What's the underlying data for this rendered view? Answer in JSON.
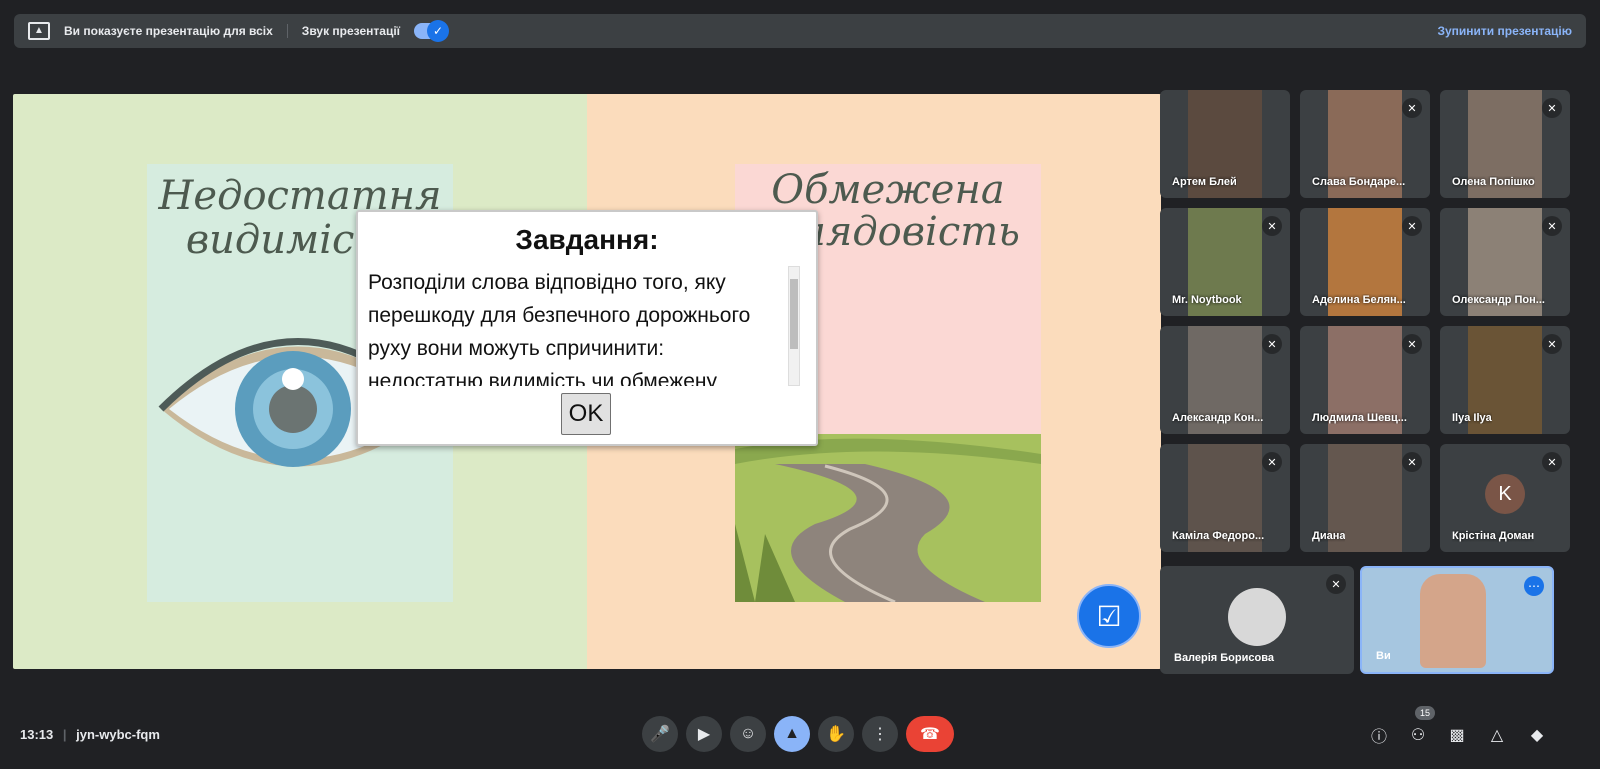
{
  "banner": {
    "presenting_text": "Ви показуєте презентацію для всіх",
    "sound_label": "Звук презентації",
    "stop_label": "Зупинити презентацію",
    "toggle_on": true
  },
  "slide": {
    "left_title_line1": "Недостатня",
    "left_title_line2": "видимість",
    "right_title_line1": "Обмежена",
    "right_title_line2": "оглядовість"
  },
  "dialog": {
    "heading": "Завдання:",
    "body": "Розподіли слова відповідно того, яку перешкоду для безпечного дорожнього руху вони можуть спричинити: недостатню видимість чи обмежену оглядовість.",
    "ok_label": "OK"
  },
  "participants": [
    {
      "name": "Артем Блей",
      "muted": false,
      "color": "#5b4a3f"
    },
    {
      "name": "Слава Бондаре...",
      "muted": true,
      "color": "#8a6a58"
    },
    {
      "name": "Олена Попішко",
      "muted": true,
      "color": "#7d6e63"
    },
    {
      "name": "Mr. Noytbook",
      "muted": true,
      "color": "#6e7a4e"
    },
    {
      "name": "Аделина Белян...",
      "muted": true,
      "color": "#b3763e"
    },
    {
      "name": "Олександр Пон...",
      "muted": true,
      "color": "#8c8176"
    },
    {
      "name": "Александр Кон...",
      "muted": true,
      "color": "#6f6964"
    },
    {
      "name": "Людмила Шевц...",
      "muted": true,
      "color": "#8c6f66"
    },
    {
      "name": "Ilya Ilya",
      "muted": true,
      "color": "#6a5436"
    },
    {
      "name": "Каміла Федоро...",
      "muted": true,
      "color": "#5e534c"
    },
    {
      "name": "Диана",
      "muted": true,
      "color": "#64574f"
    },
    {
      "name": "Крістіна Доман",
      "muted": true,
      "avatar_letter": "K"
    }
  ],
  "big_tiles": [
    {
      "name": "Валерія Борисова",
      "muted": true
    },
    {
      "name": "Ви",
      "muted": false
    }
  ],
  "footer": {
    "time": "13:13",
    "meeting_code": "jyn-wybc-fqm",
    "people_count": "15"
  }
}
